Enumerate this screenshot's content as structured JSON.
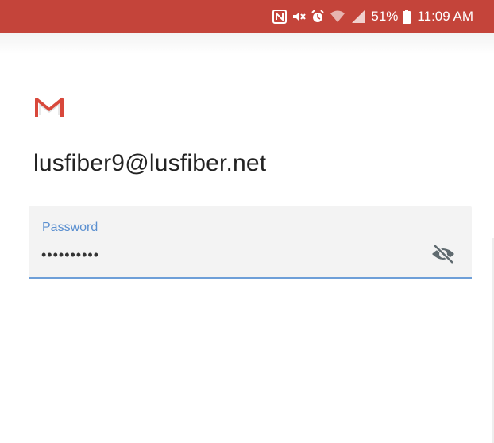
{
  "status_bar": {
    "background": "#c4443a",
    "icons": [
      "nfc-icon",
      "mute-icon",
      "alarm-icon",
      "wifi-icon",
      "signal-icon",
      "battery-icon"
    ],
    "battery": "51%",
    "time": "11:09 AM"
  },
  "account": {
    "logo": "gmail-logo",
    "email": "lusfiber9@lusfiber.net"
  },
  "password": {
    "label": "Password",
    "value": "••••••••••",
    "accent": "#6e9fd8",
    "toggle_icon": "visibility-off-icon"
  }
}
